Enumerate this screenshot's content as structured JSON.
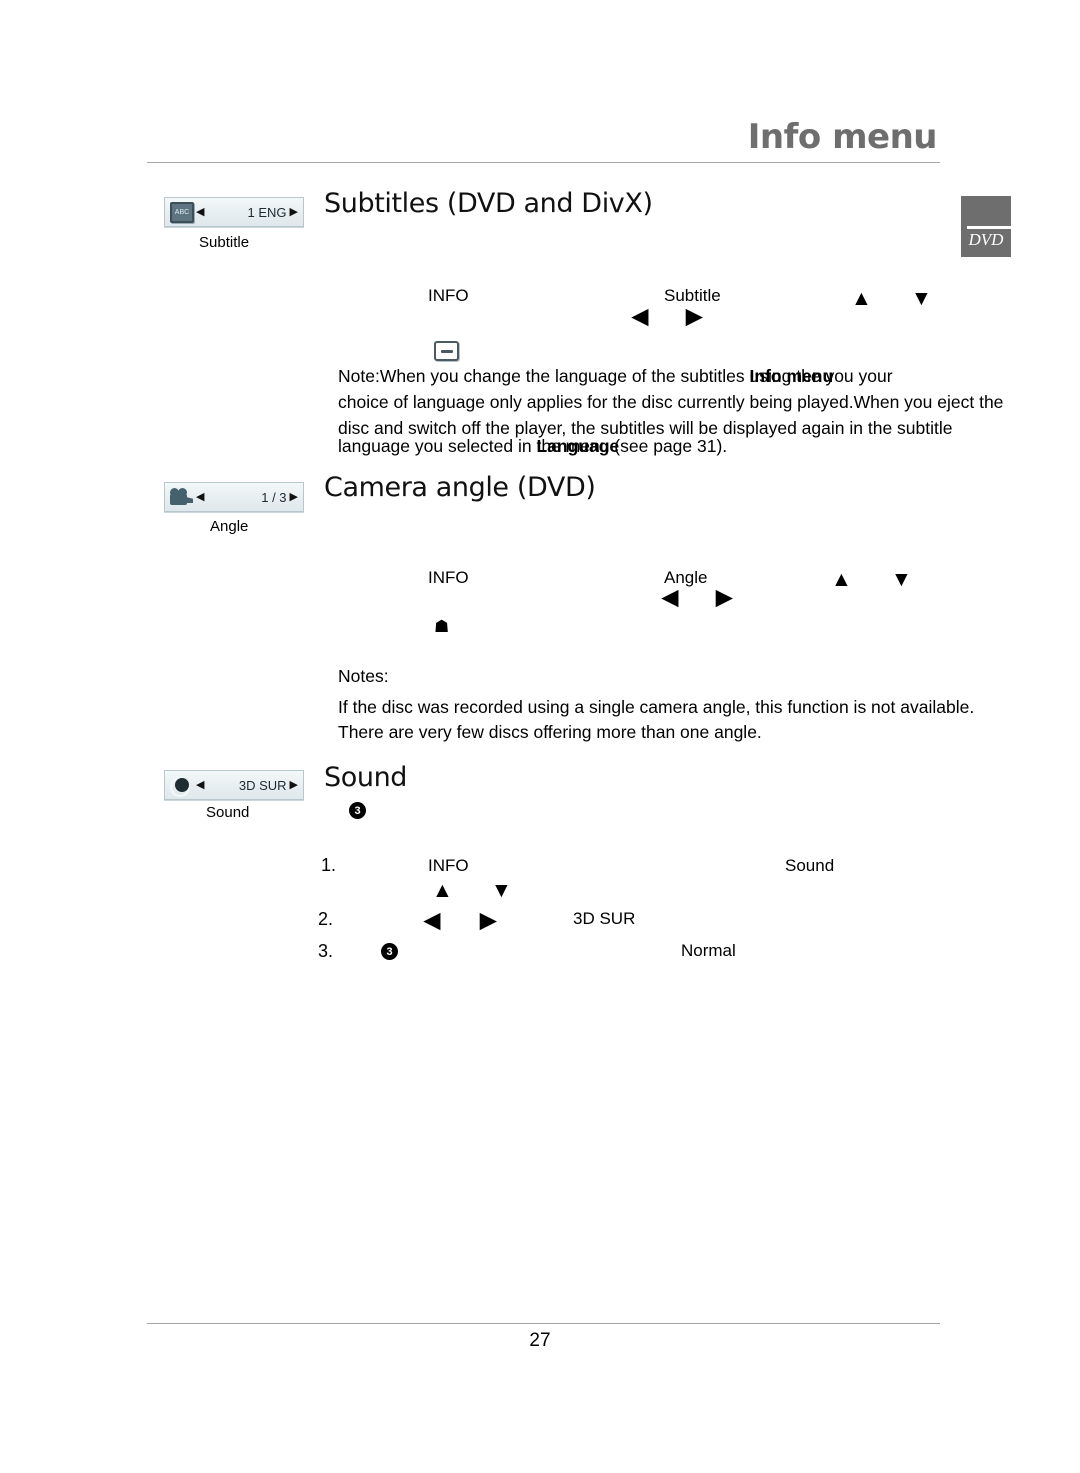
{
  "header": {
    "title": "Info menu"
  },
  "media_badge": {
    "label": "DVD"
  },
  "sections": {
    "subtitles": {
      "title": "Subtitles (DVD and DivX)",
      "osd_key": {
        "icon": "abc-subtitle-icon",
        "left_arrow": "◀",
        "value": "1 ENG",
        "right_arrow": "▶",
        "caption": "Subtitle"
      },
      "steps_tokens": {
        "info": "INFO",
        "subtitle": "Subtitle",
        "up": "▲",
        "down": "▼",
        "left": "◀",
        "right": "▶"
      },
      "note": {
        "line1_a": "Note:When you change the language of the subtitles ",
        "line1_under": "using the",
        "line1_over": "Info menu",
        "line1_b": " you your",
        "line2": "choice of language only applies for the disc currently being played.When you eject the",
        "line3": "disc and switch off the player, the subtitles will be displayed again in the subtitle",
        "line4_a": "language you selected in ",
        "line4_under": "the",
        "line4_over": "Language",
        "line4_b": "   menu (see page 31)."
      }
    },
    "camera_angle": {
      "title": "Camera angle (DVD)",
      "osd_key": {
        "icon": "camera-icon",
        "left_arrow": "◀",
        "value": "1 / 3",
        "right_arrow": "▶",
        "caption": "Angle"
      },
      "steps_tokens": {
        "info": "INFO",
        "angle": "Angle",
        "up": "▲",
        "down": "▼",
        "left": "◀",
        "right": "▶"
      },
      "notes_heading": "Notes:",
      "notes": [
        "If the disc was recorded using a single camera angle, this function is not available.",
        "There are very few discs offering more than one angle."
      ]
    },
    "sound": {
      "title": "Sound",
      "osd_key": {
        "icon": "sound-icon",
        "left_arrow": "◀",
        "value": "3D SUR",
        "right_arrow": "▶",
        "caption": "Sound"
      },
      "badge": "3",
      "steps": [
        {
          "number": "1.",
          "info": "INFO",
          "up": "▲",
          "down": "▼",
          "target": "Sound"
        },
        {
          "number": "2.",
          "left": "◀",
          "right": "▶",
          "target": "3D SUR"
        },
        {
          "number": "3.",
          "badge": "3",
          "target": "Normal"
        }
      ]
    }
  },
  "footer": {
    "page_number": "27"
  }
}
